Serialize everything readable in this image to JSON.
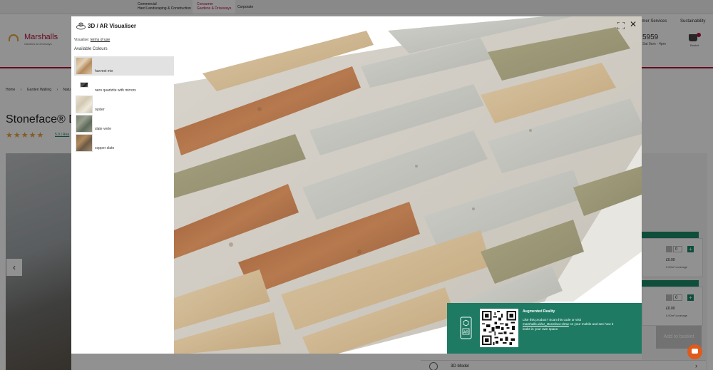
{
  "background_page": {
    "topbar": {
      "commercial": {
        "title": "Commercial",
        "subtitle": "Hard Landscaping & Construction"
      },
      "consumer": {
        "title": "Consumer",
        "subtitle": "Gardens & Driveways"
      },
      "corporate": "Corporate"
    },
    "header": {
      "brand": "Marshalls",
      "brand_sub": "Gardens & Driveways",
      "links": [
        "omer Services",
        "Sustainability"
      ],
      "phone_partial": "5959",
      "hours_partial": "Sat 9am - 4pm",
      "basket_label": "Basket"
    },
    "breadcrumb": [
      "Home",
      "›",
      "Garden Walling",
      "›",
      "Natu"
    ],
    "product_title_partial": "Stoneface® D",
    "rating_stars": "★★★★★",
    "reviews_link": "5.0 | Rea",
    "quantity_rows": [
      {
        "qty": "0",
        "price": "£0.00",
        "coverage": "0.00m² coverage"
      },
      {
        "qty": "0",
        "price": "£0.00",
        "coverage": "0.00m² coverage"
      }
    ],
    "add_to_basket": "Add to basket",
    "model_row_label": "3D Model",
    "gallery_prev": "‹",
    "chevron": "›"
  },
  "modal": {
    "title": "3D / AR Visualiser",
    "visualise_prefix": "Visualise:",
    "terms_link": "terms of use",
    "colours_heading": "Available Colours",
    "colours": [
      {
        "label": "harvest mix",
        "selected": true
      },
      {
        "label": "nero quartzite with mirrors",
        "selected": false
      },
      {
        "label": "oyster",
        "selected": false
      },
      {
        "label": "slate verte",
        "selected": false
      },
      {
        "label": "copper slate",
        "selected": false
      }
    ],
    "close": "✕",
    "ar": {
      "title": "Augmented Reality",
      "line1": "Like this product? Scan this code or visit",
      "link": "marshalls.uk/ar_stoneface-dmw",
      "line2": "on your mobile and see how it",
      "line3": "looks in your own space.",
      "phone_badge": "AR"
    }
  },
  "colors": {
    "brand": "#b0103a",
    "accent_green": "#1e7a63",
    "star": "#e8a33d"
  }
}
